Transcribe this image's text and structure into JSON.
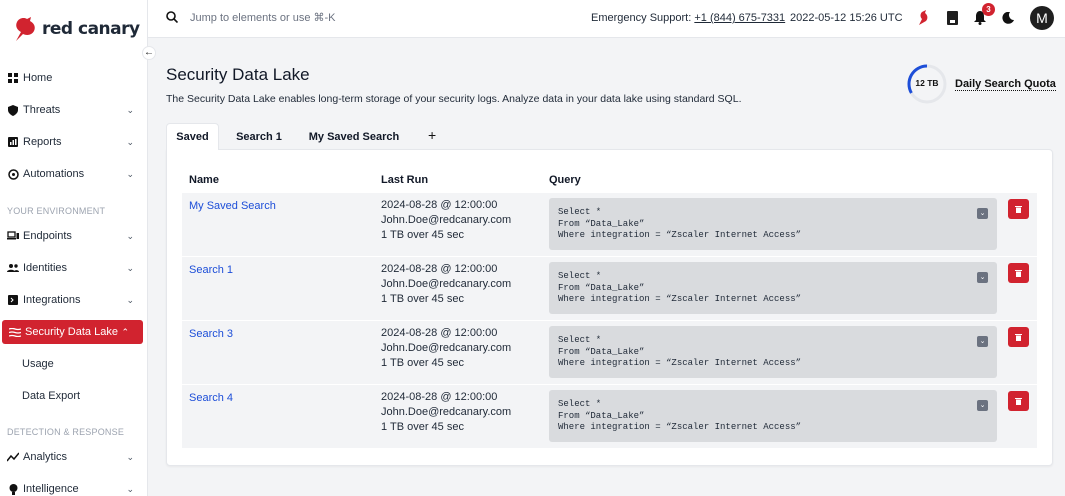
{
  "brand": {
    "name": "red canary",
    "accent": "#d1232f"
  },
  "sidebar": {
    "items": [
      {
        "label": "Home",
        "icon": "home-icon"
      },
      {
        "label": "Threats",
        "icon": "shield-icon"
      },
      {
        "label": "Reports",
        "icon": "reports-icon"
      },
      {
        "label": "Automations",
        "icon": "automations-icon"
      },
      {
        "label": "Endpoints",
        "icon": "endpoints-icon"
      },
      {
        "label": "Identities",
        "icon": "identities-icon"
      },
      {
        "label": "Integrations",
        "icon": "integrations-icon"
      },
      {
        "label": "Security Data Lake",
        "icon": "data-lake-icon"
      },
      {
        "label": "Analytics",
        "icon": "analytics-icon"
      },
      {
        "label": "Intelligence",
        "icon": "intelligence-icon"
      }
    ],
    "subitems": [
      "Usage",
      "Data Export"
    ],
    "sections": [
      "YOUR ENVIRONMENT",
      "DETECTION & RESPONSE"
    ]
  },
  "topbar": {
    "search_placeholder": "Jump to elements or use ⌘-K",
    "emergency_label": "Emergency Support:",
    "emergency_phone": "+1 (844) 675-7331",
    "datetime": "2022-05-12 15:26 UTC",
    "notification_count": "3",
    "avatar_initial": "M"
  },
  "main": {
    "title": "Security Data Lake",
    "description": "The Security Data Lake enables long-term storage of your security logs. Analyze data in your data lake using standard SQL.",
    "quota": {
      "value": "12 TB",
      "label": "Daily Search Quota"
    },
    "tabs": [
      "Saved",
      "Search 1",
      "My Saved Search"
    ],
    "columns": [
      "Name",
      "Last Run",
      "Query"
    ],
    "rows": [
      {
        "name": "My Saved Search",
        "run_date": "2024-08-28 @ 12:00:00",
        "run_user": "John.Doe@redcanary.com",
        "run_stats": "1 TB over 45 sec",
        "query": "Select *\nFrom “Data_Lake”\nWhere integration = “Zscaler Internet Access”"
      },
      {
        "name": "Search 1",
        "run_date": "2024-08-28 @ 12:00:00",
        "run_user": "John.Doe@redcanary.com",
        "run_stats": "1 TB over 45 sec",
        "query": "Select *\nFrom “Data_Lake”\nWhere integration = “Zscaler Internet Access”"
      },
      {
        "name": "Search 3",
        "run_date": "2024-08-28 @ 12:00:00",
        "run_user": "John.Doe@redcanary.com",
        "run_stats": "1 TB over 45 sec",
        "query": "Select *\nFrom “Data_Lake”\nWhere integration = “Zscaler Internet Access”"
      },
      {
        "name": "Search 4",
        "run_date": "2024-08-28 @ 12:00:00",
        "run_user": "John.Doe@redcanary.com",
        "run_stats": "1 TB over 45 sec",
        "query": "Select *\nFrom “Data_Lake”\nWhere integration = “Zscaler Internet Access”"
      }
    ]
  }
}
